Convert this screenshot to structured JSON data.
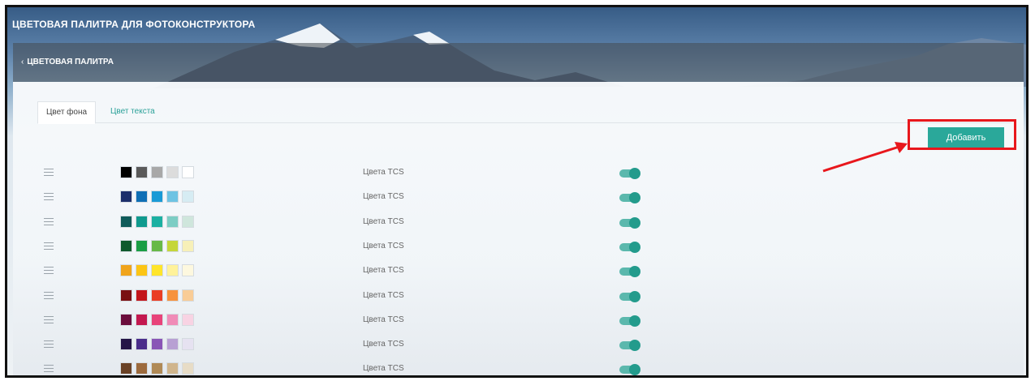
{
  "header": {
    "title": "ЦВЕТОВАЯ ПАЛИТРА ДЛЯ ФОТОКОНСТРУКТОРА"
  },
  "subheader": {
    "back_label": "ЦВЕТОВАЯ ПАЛИТРА",
    "back_icon": "chevron-left-icon"
  },
  "tabs": [
    {
      "label": "Цвет фона",
      "active": true
    },
    {
      "label": "Цвет текста",
      "active": false
    }
  ],
  "actions": {
    "add_label": "Добавить"
  },
  "accent": "#2aa89a",
  "palettes": [
    {
      "label": "Цвета TCS",
      "enabled": true,
      "colors": [
        "#000000",
        "#5a5a5a",
        "#a8a8a8",
        "#dcdcdc",
        "#ffffff"
      ]
    },
    {
      "label": "Цвета TCS",
      "enabled": true,
      "colors": [
        "#1c2f6b",
        "#0f6fb5",
        "#1a9ad6",
        "#6ec3e3",
        "#d6ecf3"
      ]
    },
    {
      "label": "Цвета TCS",
      "enabled": true,
      "colors": [
        "#0f5b5a",
        "#0f9a8e",
        "#1bb0a2",
        "#7ccdc4",
        "#cfe6dc"
      ]
    },
    {
      "label": "Цвета TCS",
      "enabled": true,
      "colors": [
        "#0e5a2c",
        "#1a9e45",
        "#67b948",
        "#c5d63a",
        "#f7f0b8"
      ]
    },
    {
      "label": "Цвета TCS",
      "enabled": true,
      "colors": [
        "#f0a41b",
        "#fcc515",
        "#ffe52a",
        "#fff29a",
        "#fdf8df"
      ]
    },
    {
      "label": "Цвета TCS",
      "enabled": true,
      "colors": [
        "#7a1012",
        "#c3161c",
        "#ea3d24",
        "#f7923d",
        "#f9cc96"
      ]
    },
    {
      "label": "Цвета TCS",
      "enabled": true,
      "colors": [
        "#6b0d3c",
        "#c3184f",
        "#e8437a",
        "#f08bb7",
        "#f8d3e3"
      ]
    },
    {
      "label": "Цвета TCS",
      "enabled": true,
      "colors": [
        "#241447",
        "#4a2d8b",
        "#8955b6",
        "#b8a0d3",
        "#e6e2f1"
      ]
    },
    {
      "label": "Цвета TCS",
      "enabled": true,
      "colors": [
        "#6a4226",
        "#9c6a3d",
        "#b08a56",
        "#d0b58c",
        "#e7dcc6"
      ]
    }
  ]
}
